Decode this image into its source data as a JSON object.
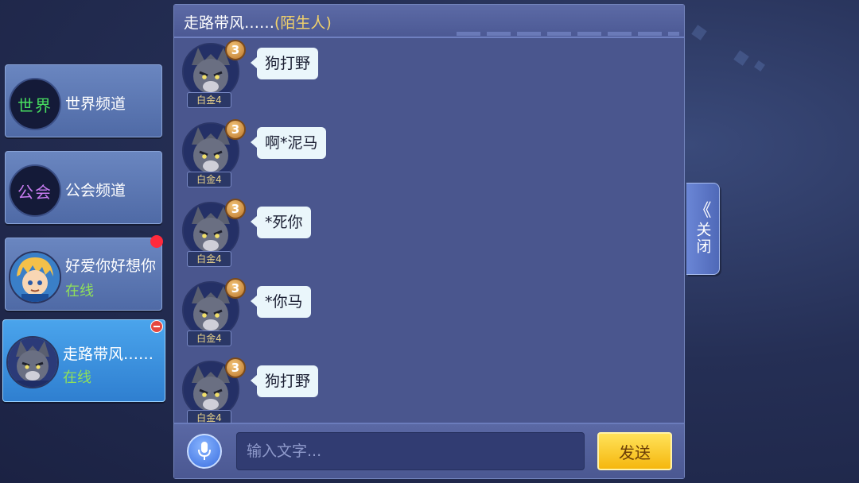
{
  "channels": [
    {
      "icon_text": "世界",
      "icon_color": "#48e060",
      "label": "世界频道"
    },
    {
      "icon_text": "公会",
      "icon_color": "#c77bf0",
      "label": "公会频道"
    }
  ],
  "friends": [
    {
      "name": "好爱你好想你",
      "status": "在线",
      "badge": "red-dot"
    },
    {
      "name": "走路带风……",
      "status": "在线",
      "badge": "remove-icon"
    }
  ],
  "chat": {
    "title": "走路带风……",
    "subtitle": "(陌生人)",
    "messages": [
      {
        "rank_level": "3",
        "rank_label": "白金4",
        "text": "狗打野"
      },
      {
        "rank_level": "3",
        "rank_label": "白金4",
        "text": "啊*泥马"
      },
      {
        "rank_level": "3",
        "rank_label": "白金4",
        "text": "*死你"
      },
      {
        "rank_level": "3",
        "rank_label": "白金4",
        "text": "*你马"
      },
      {
        "rank_level": "3",
        "rank_label": "白金4",
        "text": "狗打野"
      }
    ],
    "input_placeholder": "输入文字...",
    "send_label": "发送"
  },
  "close_tab": {
    "chevron": "《",
    "label": "关闭"
  },
  "colors": {
    "accent_send": "#f7c21d",
    "online": "#8fe05a",
    "panel": "#4a568e"
  }
}
